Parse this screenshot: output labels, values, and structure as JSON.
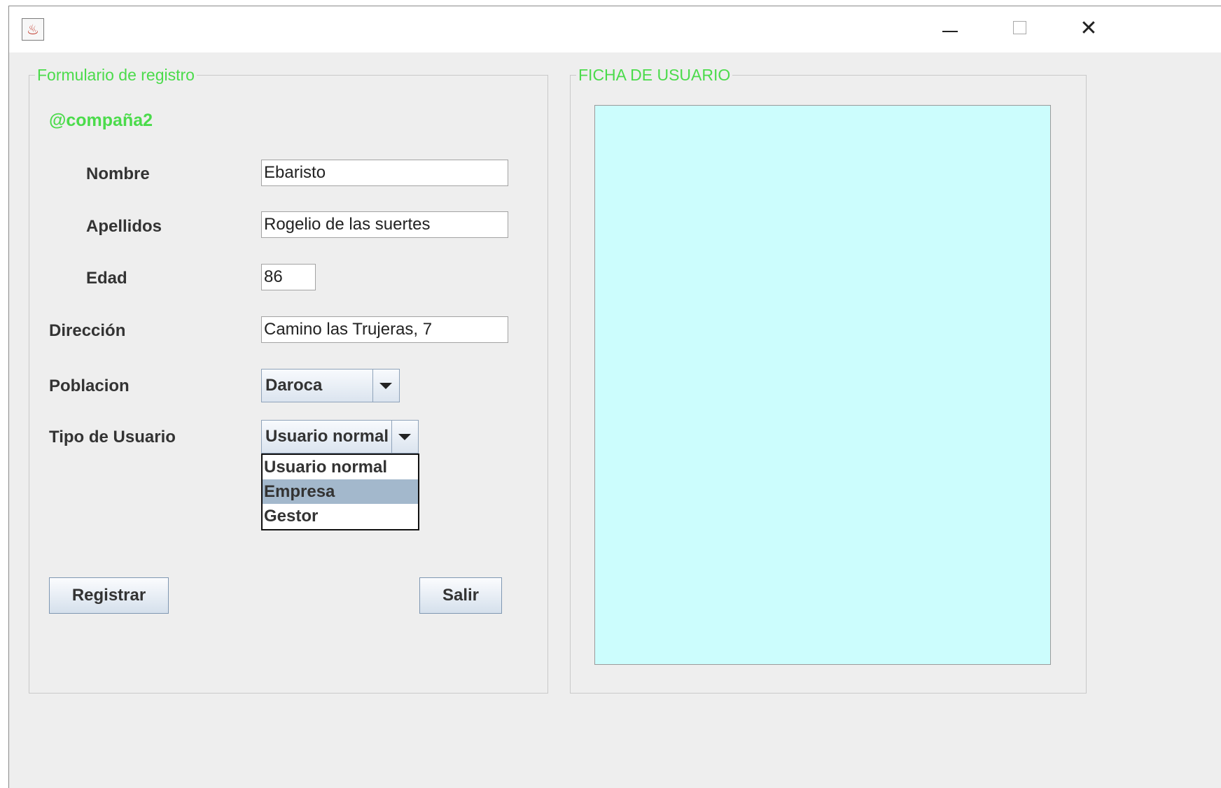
{
  "window": {
    "app_icon": "java-cup-icon",
    "minimize_icon": "minimize-icon",
    "maximize_icon": "maximize-icon",
    "close_icon": "close-icon",
    "close_glyph": "✕"
  },
  "form": {
    "legend": "Formulario de registro",
    "company": "@compaña2",
    "fields": {
      "nombre": {
        "label": "Nombre",
        "value": "Ebaristo"
      },
      "apellidos": {
        "label": "Apellidos",
        "value": "Rogelio de las suertes"
      },
      "edad": {
        "label": "Edad",
        "value": "86"
      },
      "direccion": {
        "label": "Dirección",
        "value": "Camino las Trujeras, 7"
      }
    },
    "poblacion": {
      "label": "Poblacion",
      "selected": "Daroca"
    },
    "tipo_usuario": {
      "label": "Tipo de Usuario",
      "selected": "Usuario normal",
      "options": [
        "Usuario normal",
        "Empresa",
        "Gestor"
      ],
      "highlighted": "Empresa"
    },
    "buttons": {
      "registrar": "Registrar",
      "salir": "Salir"
    }
  },
  "ficha": {
    "legend": "FICHA DE USUARIO",
    "background_color": "#ccfdfd"
  },
  "colors": {
    "legend_green": "#4bdb4b",
    "highlight": "#a3b8cc"
  }
}
